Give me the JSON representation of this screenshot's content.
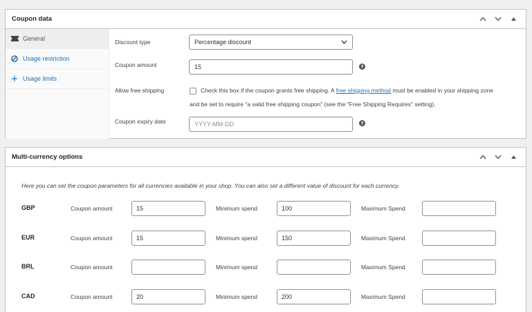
{
  "coupon_data": {
    "title": "Coupon data",
    "tabs": [
      {
        "label": "General",
        "icon": "ticket-icon"
      },
      {
        "label": "Usage restriction",
        "icon": "ban-icon"
      },
      {
        "label": "Usage limits",
        "icon": "plus-icon"
      }
    ],
    "discount_type": {
      "label": "Discount type",
      "value": "Percentage discount"
    },
    "coupon_amount": {
      "label": "Coupon amount",
      "value": "15"
    },
    "free_shipping": {
      "label": "Allow free shipping",
      "checked": false,
      "text_before": "Check this box if the coupon grants free shipping. A ",
      "link": "free shipping method",
      "text_after": " must be enabled in your shipping zone",
      "text_line2": "and be set to require \"a valid free shipping coupon\" (see the \"Free Shipping Requires\" setting)."
    },
    "expiry": {
      "label": "Coupon expiry date",
      "placeholder": "YYYY-MM-DD"
    }
  },
  "multi_currency": {
    "title": "Multi-currency options",
    "description": "Here you can set the coupon parameters for all currencies available in your shop. You can also set a different value of discount for each currency.",
    "labels": {
      "amount": "Coupon amount",
      "min": "Minimum spend",
      "max": "Maximum Spend"
    },
    "rows": [
      {
        "code": "GBP",
        "amount": "15",
        "min": "100",
        "max": ""
      },
      {
        "code": "EUR",
        "amount": "15",
        "min": "150",
        "max": ""
      },
      {
        "code": "BRL",
        "amount": "",
        "min": "",
        "max": ""
      },
      {
        "code": "CAD",
        "amount": "20",
        "min": "200",
        "max": ""
      }
    ]
  },
  "colors": {
    "link": "#2271b1",
    "border": "#c3c4c7",
    "background": "#f0f0f1"
  }
}
